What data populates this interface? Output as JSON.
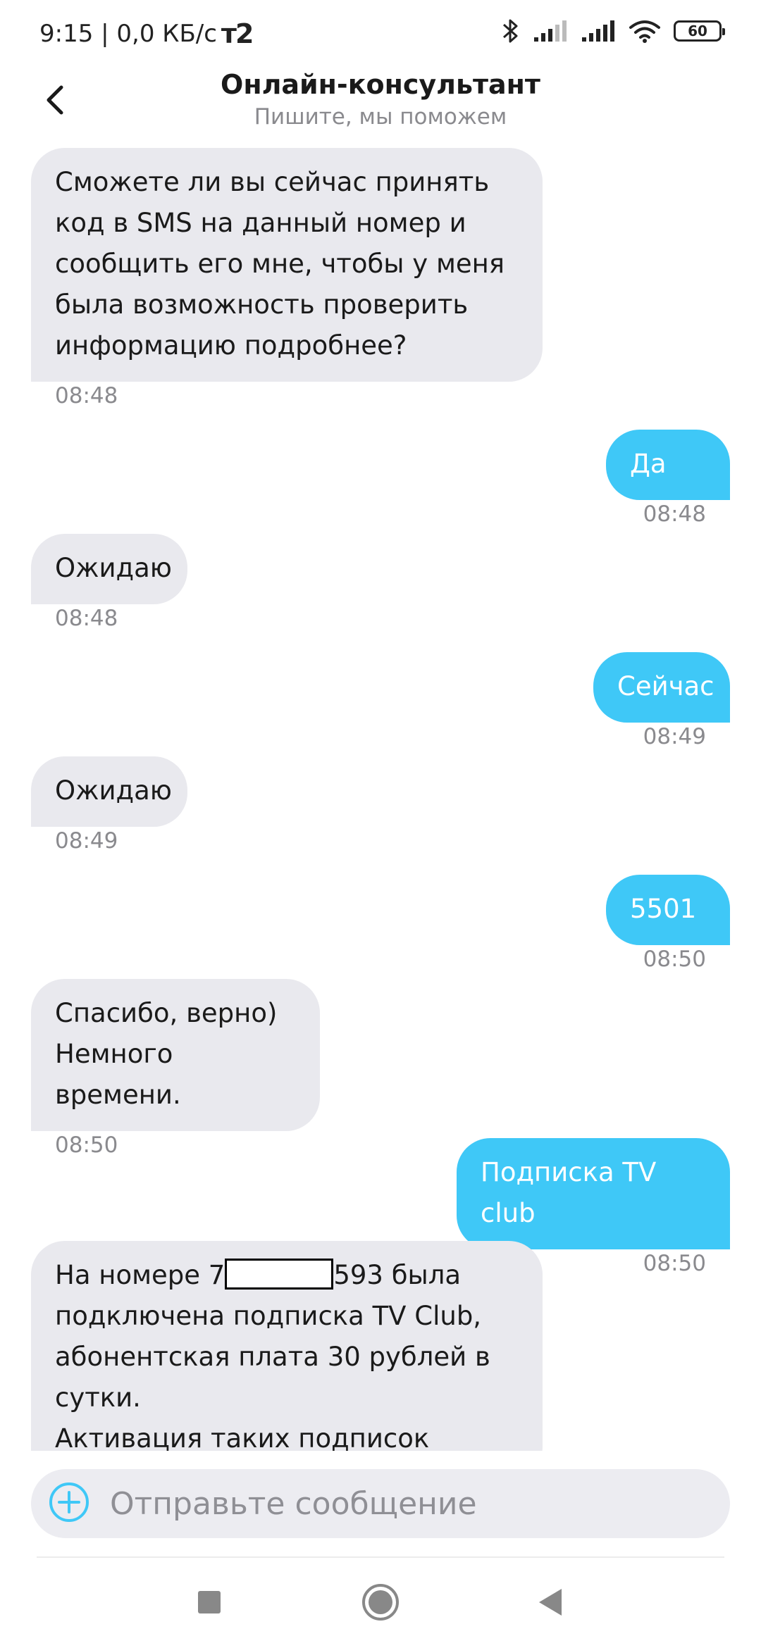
{
  "status_bar": {
    "time_network": "9:15 | 0,0 КБ/с",
    "carrier": "т2",
    "battery": "60"
  },
  "header": {
    "title": "Онлайн-консультант",
    "subtitle": "Пишите, мы поможем"
  },
  "messages": [
    {
      "text": "Сможете ли вы сейчас принять\nкод в SMS на данный номер и\nсообщить его мне, чтобы у меня\nбыла возможность проверить\nинформацию подробнее?",
      "time": "08:48"
    },
    {
      "text": "Да",
      "time": "08:48"
    },
    {
      "text": "Ожидаю",
      "time": "08:48"
    },
    {
      "text": "Сейчас",
      "time": "08:49"
    },
    {
      "text": "Ожидаю",
      "time": "08:49"
    },
    {
      "text": "5501",
      "time": "08:50"
    },
    {
      "text": "Спасибо, верно)\nНемного времени.",
      "time": "08:50"
    },
    {
      "text": "Подписка TV club",
      "time": "08:50"
    },
    {
      "text_prefix": "На номере 7",
      "text_suffix": "593 была\nподключена подписка TV Club,\nабонентская плата 30 рублей в\nсутки.\nАктивация таких подписок"
    }
  ],
  "input": {
    "placeholder": "Отправьте сообщение",
    "value": ""
  },
  "colors": {
    "outgoing_bubble": "#3fc8f7",
    "incoming_bubble": "#e9e9ee",
    "accent": "#3fc8f7"
  },
  "icons": {
    "back": "chevron-left-icon",
    "add": "plus-circle-icon",
    "nav_recent": "square-icon",
    "nav_home": "circle-icon",
    "nav_back": "triangle-back-icon"
  }
}
